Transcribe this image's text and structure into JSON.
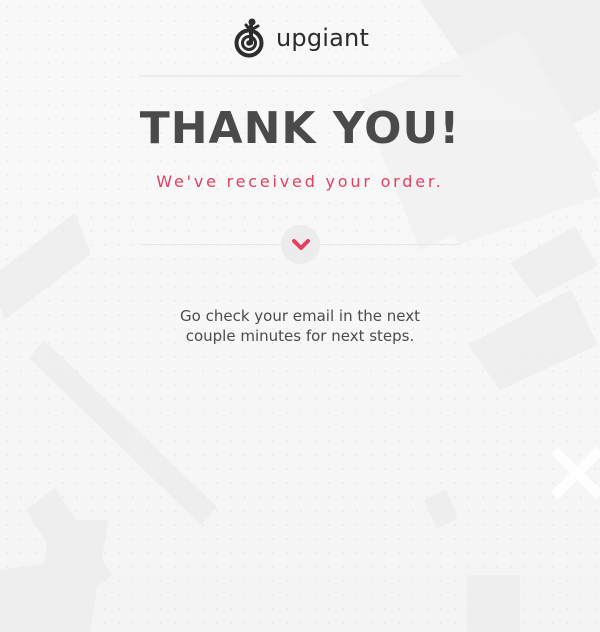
{
  "brand": {
    "logo_text": "upgiant",
    "logo_icon": "person-target-icon"
  },
  "hero": {
    "title": "THANK YOU!",
    "subtitle": "We've received your order."
  },
  "separator": {
    "icon": "chevron-down-icon",
    "accent_color": "#e4405f"
  },
  "message": {
    "line1": "Go check your email in the next",
    "line2": "couple minutes for next steps."
  }
}
